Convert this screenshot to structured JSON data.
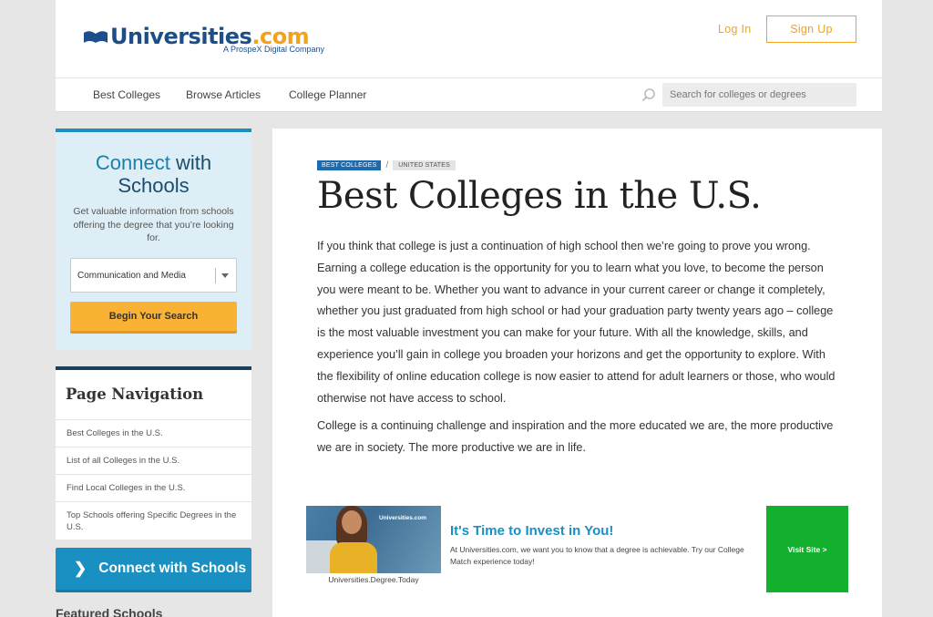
{
  "header": {
    "logo_text": "Universities",
    "logo_suffix": ".com",
    "logo_tagline": "A ProspeX Digital Company",
    "login_label": "Log In",
    "signup_label": "Sign Up"
  },
  "nav": {
    "items": [
      {
        "label": "Best Colleges"
      },
      {
        "label": "Browse Articles"
      },
      {
        "label": "College Planner"
      }
    ],
    "search_placeholder": "Search for colleges or degrees"
  },
  "connect_box": {
    "title_part1": "Connect",
    "title_part2": "with",
    "title_part3": "Schools",
    "description": "Get valuable information from schools offering the degree that you’re looking for.",
    "select_value": "Communication and Media",
    "button_label": "Begin Your Search"
  },
  "page_nav": {
    "title": "Page Navigation",
    "items": [
      {
        "label": "Best Colleges in the U.S."
      },
      {
        "label": "List of all Colleges in the U.S."
      },
      {
        "label": "Find Local Colleges in the U.S."
      },
      {
        "label": "Top Schools offering Specific Degrees in the U.S."
      }
    ]
  },
  "connect_button": {
    "label": "Connect with Schools",
    "icon": "chevron-right-icon"
  },
  "featured_heading": "Featured Schools",
  "main": {
    "breadcrumbs": [
      "BEST COLLEGES",
      "UNITED STATES"
    ],
    "breadcrumb_separator": "/",
    "title": "Best Colleges in the U.S.",
    "paragraphs": [
      "If you think that college is just a continuation of high school then we’re going to prove you wrong. Earning a college education is the opportunity for you to learn what you love, to become the person you were meant to be. Whether you want to advance in your current career or change it completely, whether you just graduated from high school or had your graduation party twenty years ago – college is the most valuable investment you can make for your future. With all the knowledge, skills, and experience you’ll gain in college you broaden your horizons and get the opportunity to explore. With the flexibility of online education college is now easier to attend for adult learners or those, who would otherwise not have access to school.",
      "College is a continuing challenge and inspiration and the more educated we are, the more productive we are in society. The more productive we are in life."
    ]
  },
  "ad": {
    "image_brand": "Universities.com",
    "caption": "Universities.Degree.Today",
    "title": "It's Time to Invest in You!",
    "text": "At Universities.com, we want you to know that a degree is achievable. Try our College Match experience today!",
    "button_label": "Visit Site >"
  },
  "colors": {
    "brand_blue": "#1c4f8a",
    "accent_orange": "#f4a21c",
    "link_blue": "#1a8fc1",
    "ad_green": "#13b02e"
  }
}
